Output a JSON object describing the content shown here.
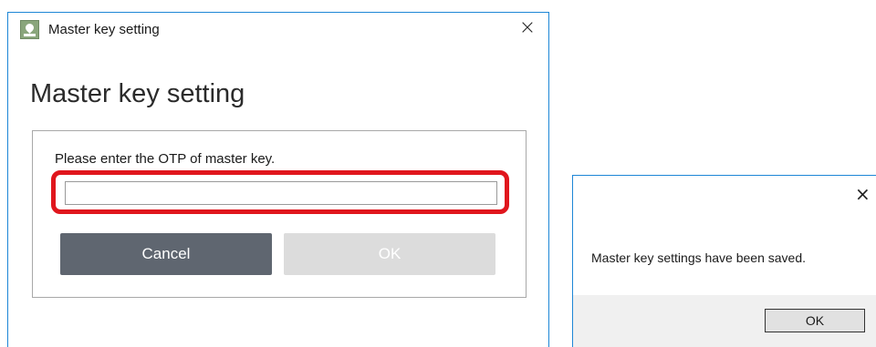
{
  "dialog": {
    "window_title": "Master key setting",
    "close_glyph": "×",
    "heading": "Master key setting",
    "prompt": "Please enter the OTP of master key.",
    "otp_input": {
      "value": "",
      "placeholder": ""
    },
    "cancel_label": "Cancel",
    "ok_label": "OK",
    "ok_enabled": false,
    "highlight_color": "#e0161d",
    "accent_border": "#1d86d6"
  },
  "message_box": {
    "close_glyph": "×",
    "text": "Master key settings have been saved.",
    "ok_label": "OK"
  },
  "icons": [
    "app-icon",
    "close-icon"
  ]
}
